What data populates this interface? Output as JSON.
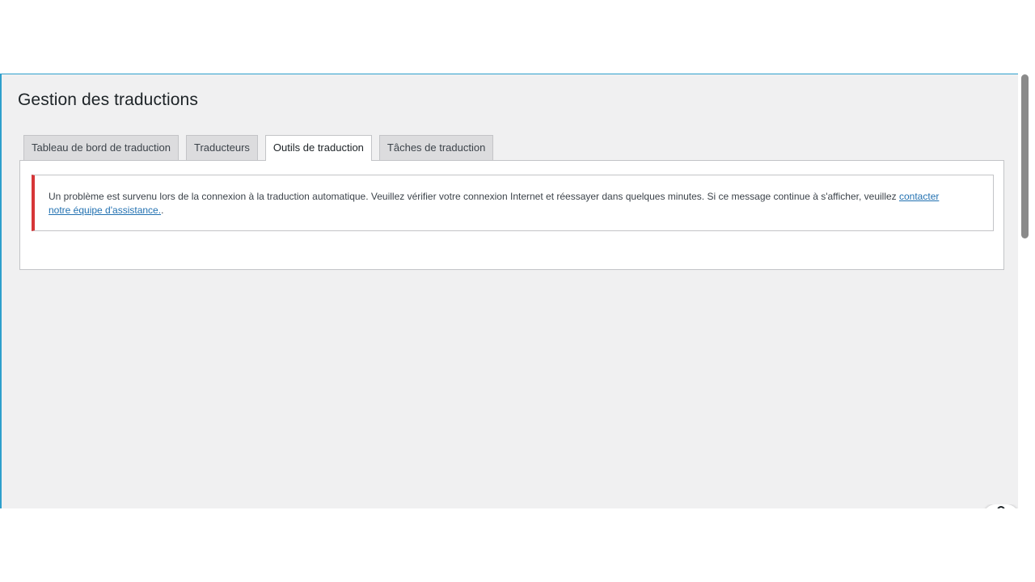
{
  "page": {
    "title": "Gestion des traductions"
  },
  "tabs": [
    {
      "label": "Tableau de bord de traduction",
      "active": false
    },
    {
      "label": "Traducteurs",
      "active": false
    },
    {
      "label": "Outils de traduction",
      "active": true
    },
    {
      "label": "Tâches de traduction",
      "active": false
    }
  ],
  "notice": {
    "type": "error",
    "message": "Un problème est survenu lors de la connexion à la traduction automatique. Veuillez vérifier votre connexion Internet et réessayer dans quelques minutes. Si ce message continue à s'afficher, veuillez ",
    "link_label": "contacter notre équipe d'assistance.",
    "suffix": "."
  },
  "colors": {
    "accent": "#2e9fcc",
    "error": "#d63638",
    "link": "#2271b1",
    "background": "#f0f0f1"
  },
  "icons": {
    "help": "help-icon"
  }
}
